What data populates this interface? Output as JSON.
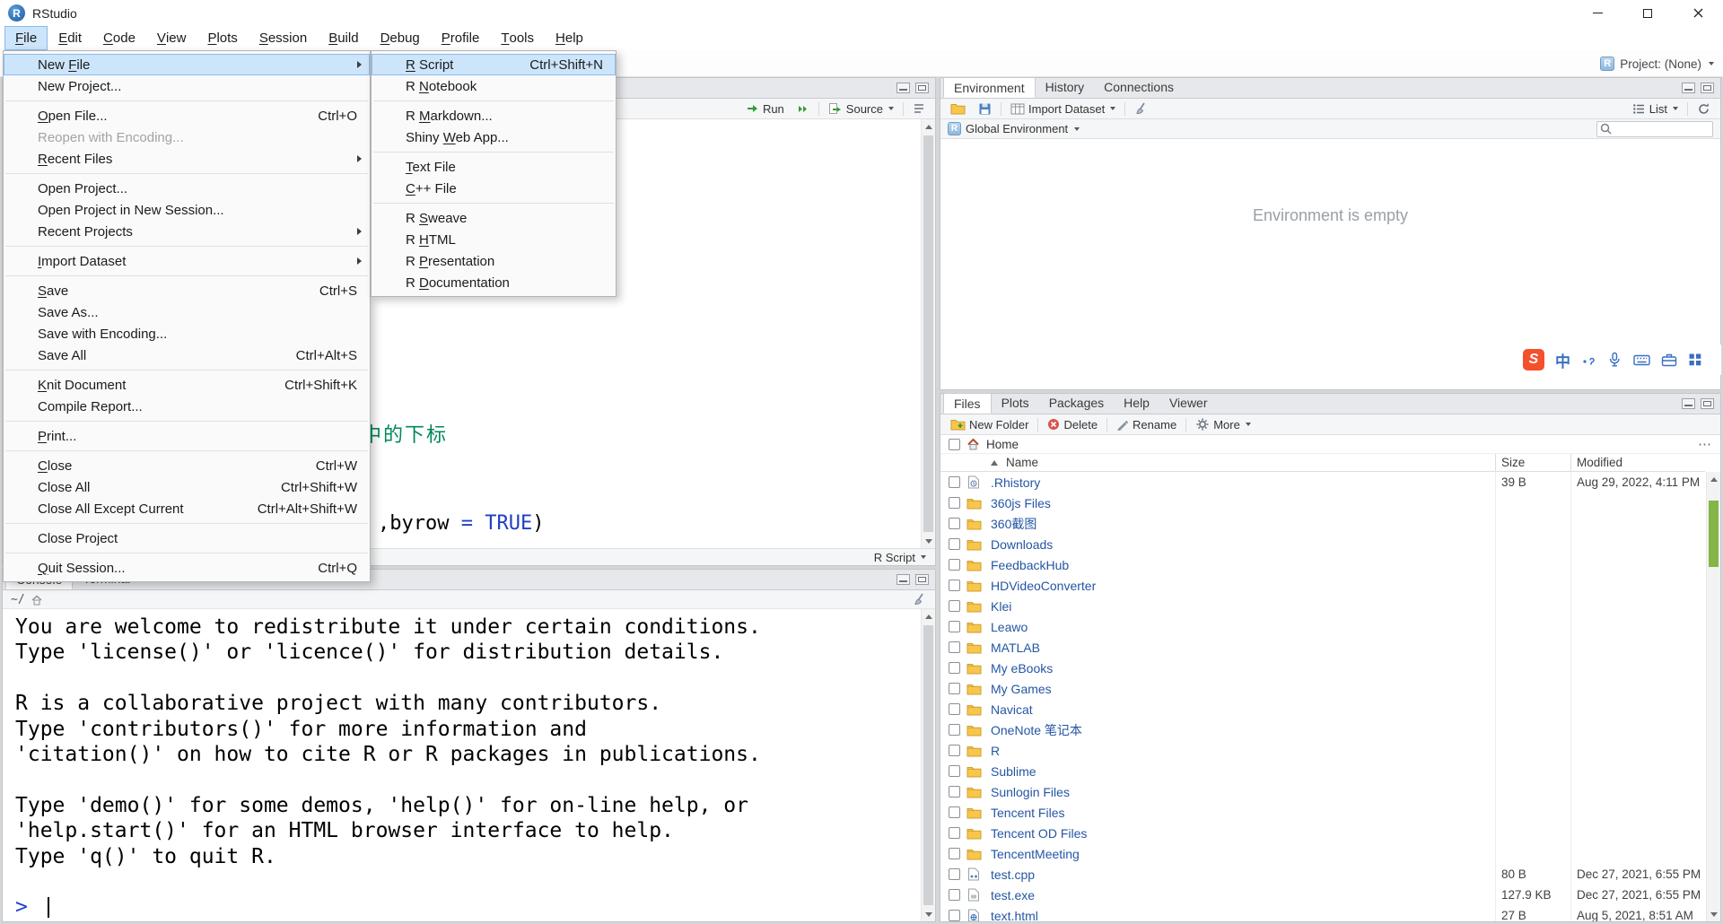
{
  "window": {
    "title": "RStudio"
  },
  "icons": {
    "r_letter": "R",
    "sogou_letter": "S"
  },
  "colors": {
    "selection_blue": "#cde5fb",
    "link_blue": "#2456a4",
    "comment_green": "#008855",
    "keyword_blue": "#2040c0",
    "folder_yellow": "#f7c64b",
    "sogou_orange": "#f4502c",
    "ime_blue": "#3a6fc0",
    "files_scrollbar_green": "#84b547"
  },
  "menubar": {
    "items": [
      {
        "label": "File",
        "mnemonic": "F",
        "active": true
      },
      {
        "label": "Edit",
        "mnemonic": "E"
      },
      {
        "label": "Code",
        "mnemonic": "C"
      },
      {
        "label": "View",
        "mnemonic": "V"
      },
      {
        "label": "Plots",
        "mnemonic": "P"
      },
      {
        "label": "Session",
        "mnemonic": "S"
      },
      {
        "label": "Build",
        "mnemonic": "B"
      },
      {
        "label": "Debug",
        "mnemonic": "D"
      },
      {
        "label": "Profile",
        "mnemonic": "P"
      },
      {
        "label": "Tools",
        "mnemonic": "T"
      },
      {
        "label": "Help",
        "mnemonic": "H"
      }
    ]
  },
  "toolbar": {
    "project_label": "Project: (None)"
  },
  "file_menu": {
    "items": [
      {
        "label": "New File",
        "mnemonic": "F",
        "submenu": true,
        "highlighted": true
      },
      {
        "label": "New Project..."
      },
      {
        "type": "separator"
      },
      {
        "label": "Open File...",
        "shortcut": "Ctrl+O",
        "mnemonic": "O"
      },
      {
        "label": "Reopen with Encoding...",
        "disabled": true
      },
      {
        "label": "Recent Files",
        "mnemonic": "R",
        "submenu": true
      },
      {
        "type": "separator"
      },
      {
        "label": "Open Project..."
      },
      {
        "label": "Open Project in New Session..."
      },
      {
        "label": "Recent Projects",
        "submenu": true
      },
      {
        "type": "separator"
      },
      {
        "label": "Import Dataset",
        "mnemonic": "I",
        "submenu": true
      },
      {
        "type": "separator"
      },
      {
        "label": "Save",
        "shortcut": "Ctrl+S",
        "mnemonic": "S"
      },
      {
        "label": "Save As..."
      },
      {
        "label": "Save with Encoding..."
      },
      {
        "label": "Save All",
        "shortcut": "Ctrl+Alt+S"
      },
      {
        "type": "separator"
      },
      {
        "label": "Knit Document",
        "shortcut": "Ctrl+Shift+K",
        "mnemonic": "K"
      },
      {
        "label": "Compile Report..."
      },
      {
        "type": "separator"
      },
      {
        "label": "Print...",
        "mnemonic": "P"
      },
      {
        "type": "separator"
      },
      {
        "label": "Close",
        "shortcut": "Ctrl+W",
        "mnemonic": "C"
      },
      {
        "label": "Close All",
        "shortcut": "Ctrl+Shift+W"
      },
      {
        "label": "Close All Except Current",
        "shortcut": "Ctrl+Alt+Shift+W"
      },
      {
        "type": "separator"
      },
      {
        "label": "Close Project"
      },
      {
        "type": "separator"
      },
      {
        "label": "Quit Session...",
        "shortcut": "Ctrl+Q",
        "mnemonic": "Q"
      }
    ]
  },
  "new_file_menu": {
    "items": [
      {
        "label": "R Script",
        "shortcut": "Ctrl+Shift+N",
        "mnemonic": "R",
        "highlighted": true
      },
      {
        "label": "R Notebook",
        "mnemonic": "N"
      },
      {
        "type": "separator"
      },
      {
        "label": "R Markdown...",
        "mnemonic": "M"
      },
      {
        "label": "Shiny Web App...",
        "mnemonic": "W"
      },
      {
        "type": "separator"
      },
      {
        "label": "Text File",
        "mnemonic": "T"
      },
      {
        "label": "C++ File",
        "mnemonic": "C"
      },
      {
        "type": "separator"
      },
      {
        "label": "R Sweave",
        "mnemonic": "S"
      },
      {
        "label": "R HTML",
        "mnemonic": "H"
      },
      {
        "label": "R Presentation",
        "mnemonic": "P"
      },
      {
        "label": "R Documentation",
        "mnemonic": "D"
      }
    ]
  },
  "source_pane": {
    "toolbar": {
      "run_label": "Run",
      "source_label": "Source"
    },
    "comment_fragment": "中的下标",
    "code_segments": [
      {
        "text": ",byrow ",
        "style": "plain"
      },
      {
        "text": "= ",
        "style": "keyword"
      },
      {
        "text": "TRUE",
        "style": "keyword"
      },
      {
        "text": ")",
        "style": "plain"
      }
    ],
    "status_file_type": "R Script"
  },
  "console_pane": {
    "tabs": [
      {
        "label": "Console",
        "active": true
      },
      {
        "label": "Terminal",
        "active": false
      }
    ],
    "working_dir": "~/",
    "lines": [
      "You are welcome to redistribute it under certain conditions.",
      "Type 'license()' or 'licence()' for distribution details.",
      "",
      "R is a collaborative project with many contributors.",
      "Type 'contributors()' for more information and",
      "'citation()' on how to cite R or R packages in publications.",
      "",
      "Type 'demo()' for some demos, 'help()' for on-line help, or",
      "'help.start()' for an HTML browser interface to help.",
      "Type 'q()' to quit R.",
      ""
    ],
    "prompt": ">"
  },
  "environment_pane": {
    "tabs": [
      {
        "label": "Environment",
        "active": true
      },
      {
        "label": "History",
        "active": false
      },
      {
        "label": "Connections",
        "active": false
      }
    ],
    "import_dataset_label": "Import Dataset",
    "list_label": "List",
    "scope_label": "Global Environment",
    "empty_message": "Environment is empty"
  },
  "ime_bar": {
    "lang_label": "中"
  },
  "files_pane": {
    "tabs": [
      {
        "label": "Files",
        "active": true
      },
      {
        "label": "Plots",
        "active": false
      },
      {
        "label": "Packages",
        "active": false
      },
      {
        "label": "Help",
        "active": false
      },
      {
        "label": "Viewer",
        "active": false
      }
    ],
    "toolbar": {
      "new_folder_label": "New Folder",
      "delete_label": "Delete",
      "rename_label": "Rename",
      "more_label": "More"
    },
    "breadcrumb_home": "Home",
    "columns": {
      "name": "Name",
      "size": "Size",
      "modified": "Modified"
    },
    "rows": [
      {
        "name": ".Rhistory",
        "icon": "history-file",
        "size": "39 B",
        "modified": "Aug 29, 2022, 4:11 PM"
      },
      {
        "name": "360js Files",
        "icon": "folder"
      },
      {
        "name": "360截图",
        "icon": "folder"
      },
      {
        "name": "Downloads",
        "icon": "folder"
      },
      {
        "name": "FeedbackHub",
        "icon": "folder"
      },
      {
        "name": "HDVideoConverter",
        "icon": "folder"
      },
      {
        "name": "Klei",
        "icon": "folder"
      },
      {
        "name": "Leawo",
        "icon": "folder"
      },
      {
        "name": "MATLAB",
        "icon": "folder"
      },
      {
        "name": "My eBooks",
        "icon": "folder"
      },
      {
        "name": "My Games",
        "icon": "folder"
      },
      {
        "name": "Navicat",
        "icon": "folder"
      },
      {
        "name": "OneNote 笔记本",
        "icon": "folder"
      },
      {
        "name": "R",
        "icon": "folder"
      },
      {
        "name": "Sublime",
        "icon": "folder"
      },
      {
        "name": "Sunlogin Files",
        "icon": "folder"
      },
      {
        "name": "Tencent Files",
        "icon": "folder"
      },
      {
        "name": "Tencent OD Files",
        "icon": "folder"
      },
      {
        "name": "TencentMeeting",
        "icon": "folder"
      },
      {
        "name": "test.cpp",
        "icon": "cpp-file",
        "size": "80 B",
        "modified": "Dec 27, 2021, 6:55 PM"
      },
      {
        "name": "test.exe",
        "icon": "exe-file",
        "size": "127.9 KB",
        "modified": "Dec 27, 2021, 6:55 PM"
      },
      {
        "name": "text.html",
        "icon": "html-file",
        "size": "27 B",
        "modified": "Aug 5, 2021, 8:51 AM"
      }
    ]
  }
}
